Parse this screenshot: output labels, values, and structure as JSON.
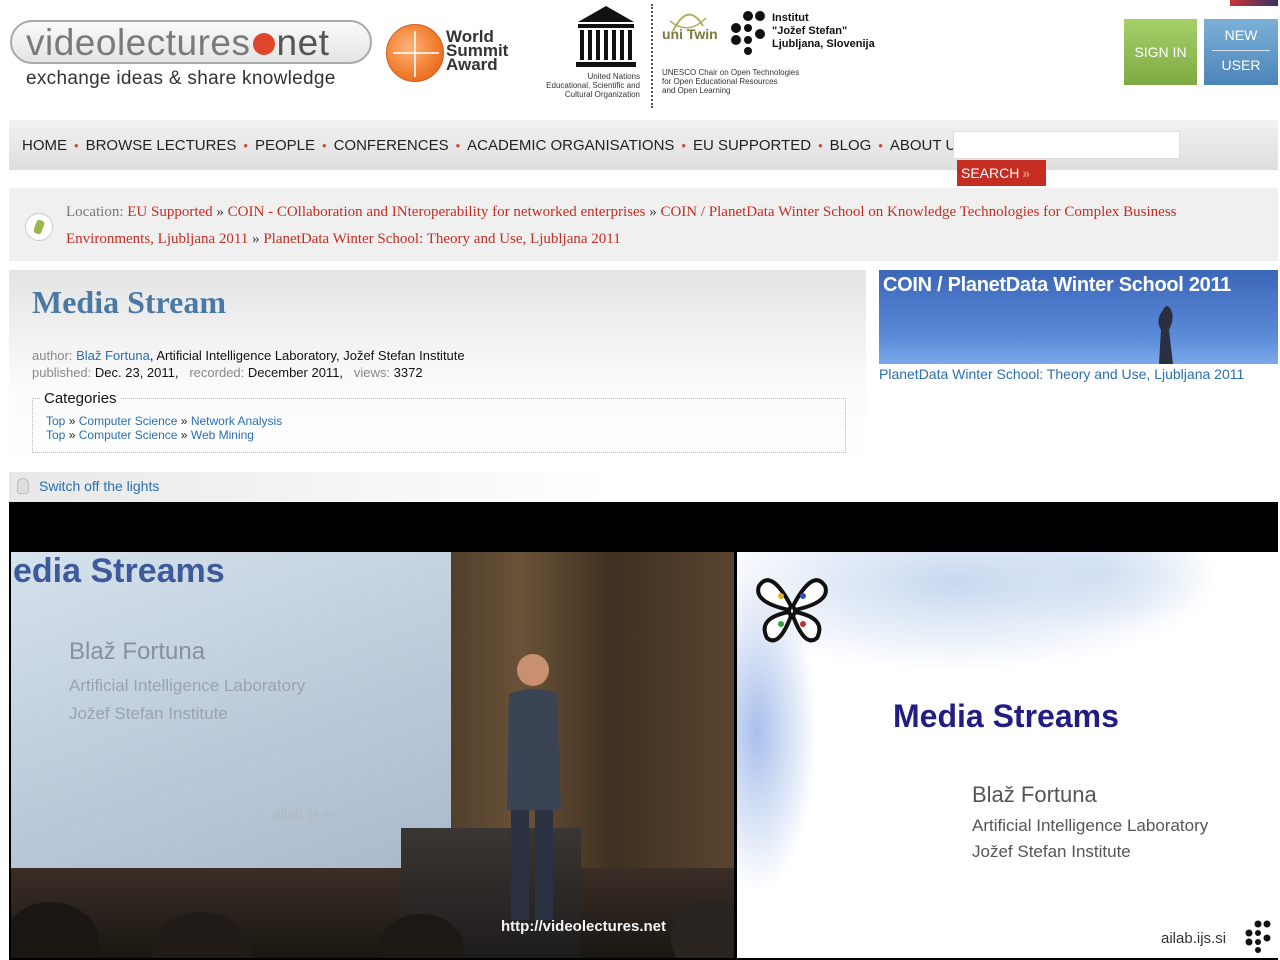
{
  "header": {
    "logo_word": "videolectures",
    "logo_net": "net",
    "tagline": "exchange ideas & share knowledge",
    "wsa": [
      "World",
      "Summit",
      "Award"
    ],
    "unesco_caption": [
      "United Nations",
      "Educational, Scientific and",
      "Cultural Organization"
    ],
    "unitwin_label": "uni Twin",
    "unitwin_caption": [
      "UNESCO Chair on Open Technologies",
      "for Open Educational Resources",
      "and Open Learning"
    ],
    "ijs": [
      "Institut",
      "\"Jožef Stefan\"",
      "Ljubljana, Slovenija"
    ],
    "sign_in": "SIGN IN",
    "new_user_1": "NEW",
    "new_user_2": "USER"
  },
  "nav": {
    "items": [
      "HOME",
      "BROWSE LECTURES",
      "PEOPLE",
      "CONFERENCES",
      "ACADEMIC ORGANISATIONS",
      "EU SUPPORTED",
      "BLOG",
      "ABOUT US"
    ],
    "separator": "•",
    "search_value": "",
    "search_button": "SEARCH",
    "search_arrow": "»"
  },
  "breadcrumb": {
    "label": "Location:",
    "items": [
      "EU Supported",
      "COIN - COllaboration and INteroperability for networked enterprises",
      "COIN / PlanetData Winter School on Knowledge Technologies for Complex Business Environments, Ljubljana 2011",
      "PlanetData Winter School: Theory and Use, Ljubljana 2011"
    ],
    "separator": "»"
  },
  "lecture": {
    "title": "Media Stream",
    "author_label": "author:",
    "author_name": "Blaž Fortuna",
    "author_affil": ", Artificial Intelligence Laboratory, Jožef Stefan Institute",
    "published_label": "published:",
    "published": "Dec. 23, 2011,",
    "recorded_label": "recorded:",
    "recorded": "December 2011,",
    "views_label": "views:",
    "views": "3372",
    "categories_label": "Categories",
    "categories": [
      [
        "Top",
        "Computer Science",
        "Network Analysis"
      ],
      [
        "Top",
        "Computer Science",
        "Web Mining"
      ]
    ]
  },
  "event": {
    "banner": "COIN / PlanetData Winter School 2011",
    "link": "PlanetData Winter School: Theory and Use, Ljubljana 2011"
  },
  "lights": "Switch off the lights",
  "video": {
    "slide_title": "edia Streams",
    "name": "Blaž Fortuna",
    "lab": "Artificial Intelligence Laboratory",
    "inst": "Jožef Stefan Institute",
    "ailab": "ailab.ijs.si",
    "watermark": "http://videolectures.net"
  },
  "slide": {
    "title": "Media Streams",
    "name": "Blaž Fortuna",
    "lab": "Artificial Intelligence Laboratory",
    "inst": "Jožef Stefan Institute",
    "ailab": "ailab.ijs.si"
  },
  "colors": {
    "accent_red": "#c62d22",
    "link_blue": "#2a6fb0",
    "title_blue": "#4a7aa4"
  }
}
